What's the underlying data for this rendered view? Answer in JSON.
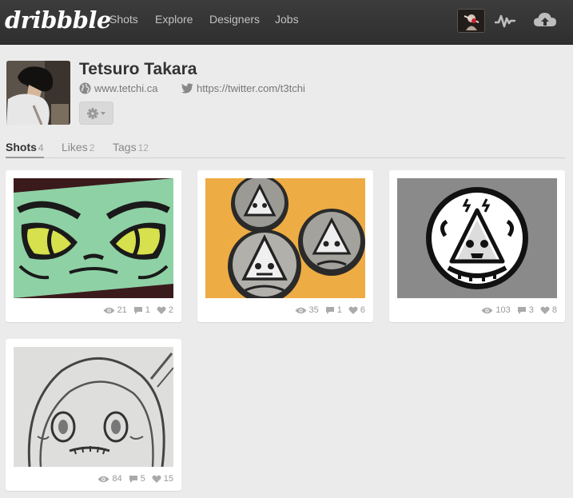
{
  "app": {
    "logo": "dribbble"
  },
  "nav": {
    "items": [
      {
        "label": "Shots"
      },
      {
        "label": "Explore"
      },
      {
        "label": "Designers"
      },
      {
        "label": "Jobs"
      }
    ],
    "icons": [
      "avatar",
      "activity-icon",
      "upload-cloud-icon"
    ]
  },
  "profile": {
    "name": "Tetsuro Takara",
    "website": "www.tetchi.ca",
    "twitter": "https://twitter.com/t3tchi"
  },
  "tabs": [
    {
      "label": "Shots",
      "count": "4"
    },
    {
      "label": "Likes",
      "count": "2"
    },
    {
      "label": "Tags",
      "count": "12"
    }
  ],
  "shots": [
    {
      "views": "21",
      "comments": "1",
      "likes": "2"
    },
    {
      "views": "35",
      "comments": "1",
      "likes": "6"
    },
    {
      "views": "103",
      "comments": "3",
      "likes": "8"
    },
    {
      "views": "84",
      "comments": "5",
      "likes": "15"
    }
  ],
  "colors": {
    "topbar": "#333333",
    "background": "#ebebeb",
    "shot1_bg": "#8ed1a5",
    "shot2_bg": "#f0a93a",
    "shot3_bg": "#8a8a8a"
  }
}
